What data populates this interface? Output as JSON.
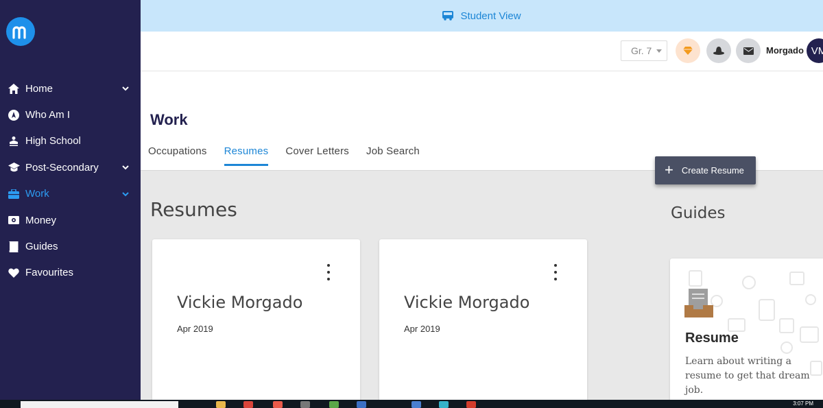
{
  "sidebar": {
    "items": [
      {
        "label": "Home",
        "icon": "home-icon"
      },
      {
        "label": "Who Am I",
        "icon": "compass-icon"
      },
      {
        "label": "High School",
        "icon": "school-icon"
      },
      {
        "label": "Post-Secondary",
        "icon": "graduation-cap-icon"
      },
      {
        "label": "Work",
        "icon": "briefcase-icon",
        "active": true
      },
      {
        "label": "Money",
        "icon": "money-icon"
      },
      {
        "label": "Guides",
        "icon": "book-icon"
      },
      {
        "label": "Favourites",
        "icon": "heart-icon"
      }
    ]
  },
  "banner": {
    "label": "Student View"
  },
  "header": {
    "grade": "Gr. 7",
    "username": "Morgado",
    "avatar_initials": "VM"
  },
  "page": {
    "title": "Work",
    "tabs": [
      {
        "label": "Occupations"
      },
      {
        "label": "Resumes",
        "active": true
      },
      {
        "label": "Cover Letters"
      },
      {
        "label": "Job Search"
      }
    ],
    "create_button": "Create Resume",
    "resumes_heading": "Resumes",
    "guides_heading": "Guides"
  },
  "resumes": [
    {
      "name": "Vickie Morgado",
      "date": "Apr 2019"
    },
    {
      "name": "Vickie Morgado",
      "date": "Apr 2019"
    }
  ],
  "guide": {
    "title": "Resume",
    "description": "Learn about writing a resume to get that dream job."
  },
  "taskbar": {
    "time": "3:07 PM"
  },
  "colors": {
    "sidebar": "#23214f",
    "accent": "#1d86d6",
    "banner": "#c8e6fb",
    "button": "#4a5064"
  }
}
